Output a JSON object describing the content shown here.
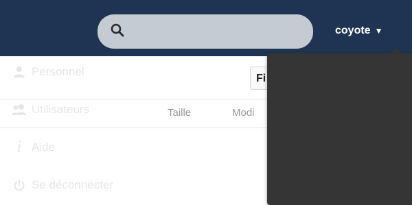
{
  "header": {
    "search": {
      "placeholder": "",
      "icon": "search-icon"
    },
    "user": {
      "name": "coyote",
      "caret": "▼"
    },
    "colors": {
      "bar": "#1f3452",
      "search_field": "#c5cbd3"
    }
  },
  "toolbar": {
    "button_label": "Fi"
  },
  "file_list": {
    "columns": [
      "Taille",
      "Modi"
    ]
  },
  "user_dropdown": {
    "background": "#353535",
    "items": [
      {
        "label": "Personnel",
        "icon": "person-icon"
      },
      {
        "label": "Utilisateurs",
        "icon": "users-icon"
      },
      {
        "label": "Aide",
        "icon": "info-icon"
      },
      {
        "label": "Se déconnecter",
        "icon": "power-icon"
      }
    ]
  }
}
